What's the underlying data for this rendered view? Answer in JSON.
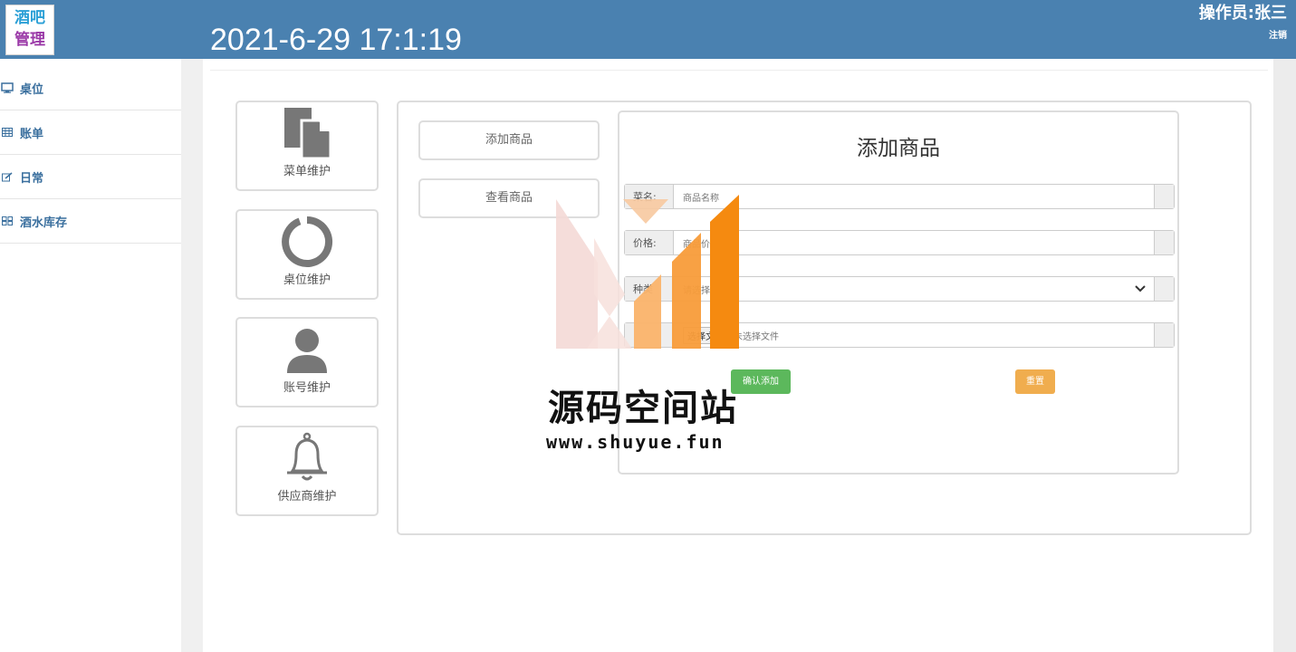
{
  "header": {
    "logo_line1": "酒吧",
    "logo_line2": "管理",
    "datetime": "2021-6-29 17:1:19",
    "operator": "操作员:张三",
    "logout": "注销"
  },
  "sidebar": {
    "items": [
      {
        "icon": "monitor-icon",
        "label": "桌位"
      },
      {
        "icon": "table-icon",
        "label": "账单"
      },
      {
        "icon": "edit-icon",
        "label": "日常"
      },
      {
        "icon": "grid-icon",
        "label": "酒水库存"
      }
    ]
  },
  "tiles": [
    {
      "icon": "file-copy-icon",
      "label": "菜单维护"
    },
    {
      "icon": "ring-icon",
      "label": "桌位维护"
    },
    {
      "icon": "user-icon",
      "label": "账号维护"
    },
    {
      "icon": "bell-icon",
      "label": "供应商维护"
    }
  ],
  "subnav": {
    "add": "添加商品",
    "view": "查看商品"
  },
  "form": {
    "title": "添加商品",
    "name_label": "菜名:",
    "name_placeholder": "商品名称",
    "price_label": "价格:",
    "price_placeholder": "商品价",
    "type_label": "种类",
    "type_value": "请选择",
    "file_button": "选择文件",
    "file_status": "未选择文件",
    "confirm": "确认添加",
    "reset": "重置"
  },
  "watermark": {
    "title": "源码空间站",
    "url": "www.shuyue.fun"
  },
  "colors": {
    "header_bg": "#4a81b0",
    "success": "#5cb85c",
    "warning": "#f0ad4e"
  }
}
